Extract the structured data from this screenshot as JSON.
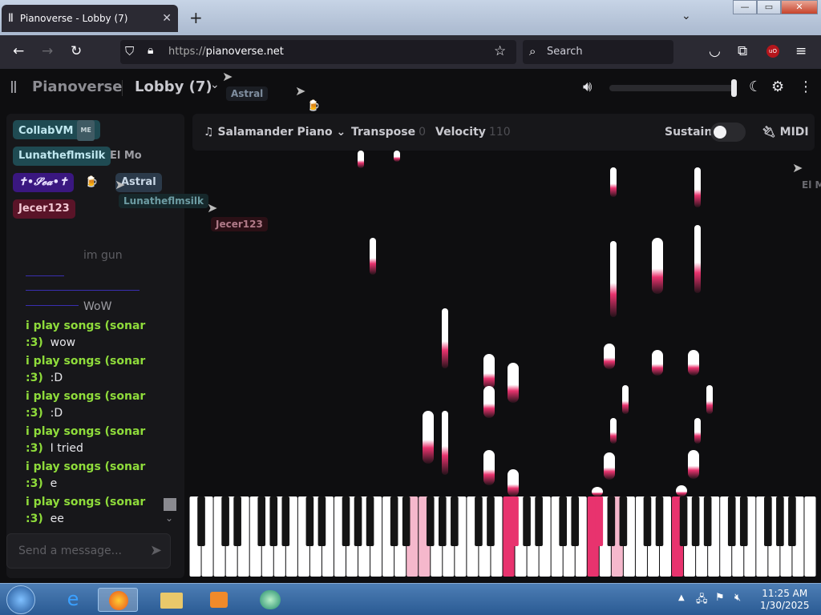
{
  "browser": {
    "tab_title": "Pianoverse - Lobby (7)",
    "tab_close": "✕",
    "new_tab": "+",
    "tab_list": "⌄",
    "url_proto": "https://",
    "url_host": "pianoverse.net",
    "search_placeholder": "Search",
    "win_min": "—",
    "win_max": "▭",
    "win_close": "✕"
  },
  "app": {
    "logo": "Pianoverse",
    "room": "Lobby (7)",
    "volume_level": 1.0,
    "sustain_on": false
  },
  "users": {
    "me_tag": "ME",
    "u1": "CollabVM",
    "u2": "Lunatheflmsilk",
    "u3": "El Mo",
    "u4": "✝•𝓢𝓮𝓪•✝",
    "u5": "Astral",
    "u6": "Jecer123"
  },
  "chat": {
    "m1": "im gun",
    "m2": "WoW",
    "name": "i play songs (sonar",
    "name_cont": ":3)",
    "t1": "wow",
    "t2": ":D",
    "t3": ":D",
    "t4": "I tried",
    "t5": "e",
    "t6": "ee",
    "input_placeholder": "Send a message..."
  },
  "instrument": {
    "name": "Salamander Piano",
    "transpose_label": "Transpose",
    "transpose_value": "0",
    "velocity_label": "Velocity",
    "velocity_value": "110",
    "sustain_label": "Sustain",
    "midi_label": "MIDI"
  },
  "cursors": {
    "c1": "Astral",
    "c2": "Lunatheflmsilk",
    "c3": "Jecer123",
    "c4": "El M"
  },
  "taskbar": {
    "time": "11:25 AM",
    "date": "1/30/2025"
  },
  "colors": {
    "accent_pink": "#e8336e",
    "chat_name": "#8fdc3b",
    "badge_teal": "#1f4a52"
  }
}
